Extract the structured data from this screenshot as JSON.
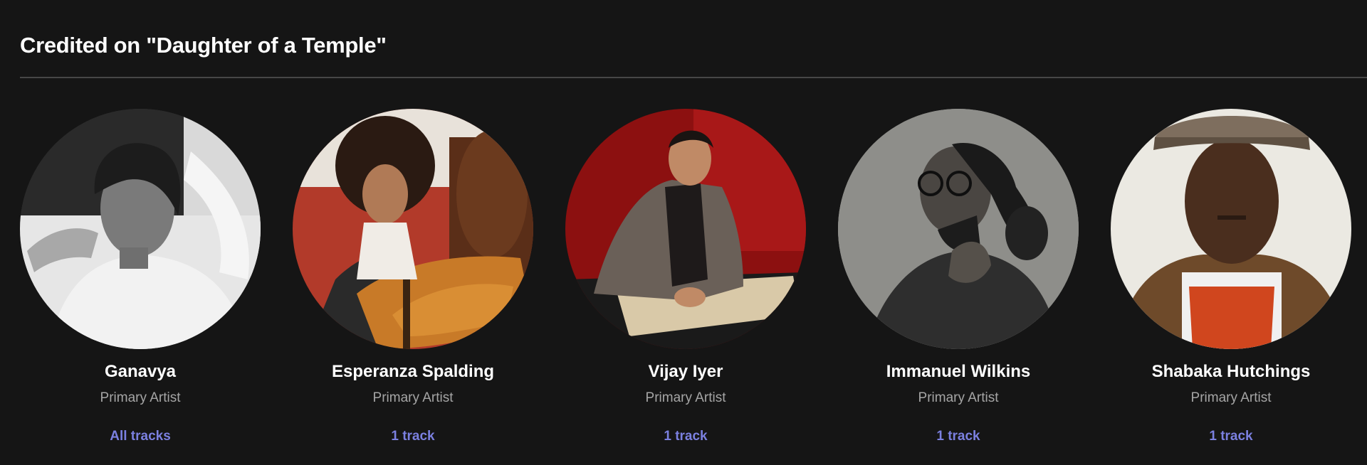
{
  "section": {
    "title": "Credited on \"Daughter of a Temple\""
  },
  "artists": [
    {
      "name": "Ganavya",
      "role": "Primary Artist",
      "tracks": "All tracks"
    },
    {
      "name": "Esperanza Spalding",
      "role": "Primary Artist",
      "tracks": "1 track"
    },
    {
      "name": "Vijay Iyer",
      "role": "Primary Artist",
      "tracks": "1 track"
    },
    {
      "name": "Immanuel Wilkins",
      "role": "Primary Artist",
      "tracks": "1 track"
    },
    {
      "name": "Shabaka Hutchings",
      "role": "Primary Artist",
      "tracks": "1 track"
    }
  ],
  "colors": {
    "background": "#151515",
    "link": "#7b80e0",
    "secondary_text": "#a5a5a5"
  }
}
